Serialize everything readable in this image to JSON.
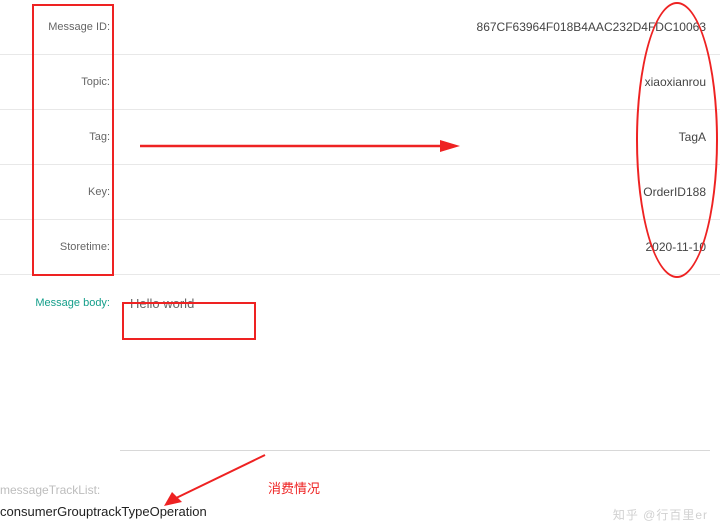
{
  "rows": {
    "message_id": {
      "label": "Message ID:",
      "value": "867CF63964F018B4AAC232D4FDC10063"
    },
    "topic": {
      "label": "Topic:",
      "value": "xiaoxianrou"
    },
    "tag": {
      "label": "Tag:",
      "value": "TagA"
    },
    "key": {
      "label": "Key:",
      "value": "OrderID188"
    },
    "storetime": {
      "label": "Storetime:",
      "value": "2020-11-10"
    }
  },
  "body": {
    "label": "Message body:",
    "value": "Hello world"
  },
  "track": {
    "label": "messageTrackList:",
    "cols": {
      "group": "consumerGroup",
      "type": "trackType",
      "op": "Operation"
    }
  },
  "annotations": {
    "consume": "消费情况"
  },
  "watermark": "知乎 @行百里er"
}
